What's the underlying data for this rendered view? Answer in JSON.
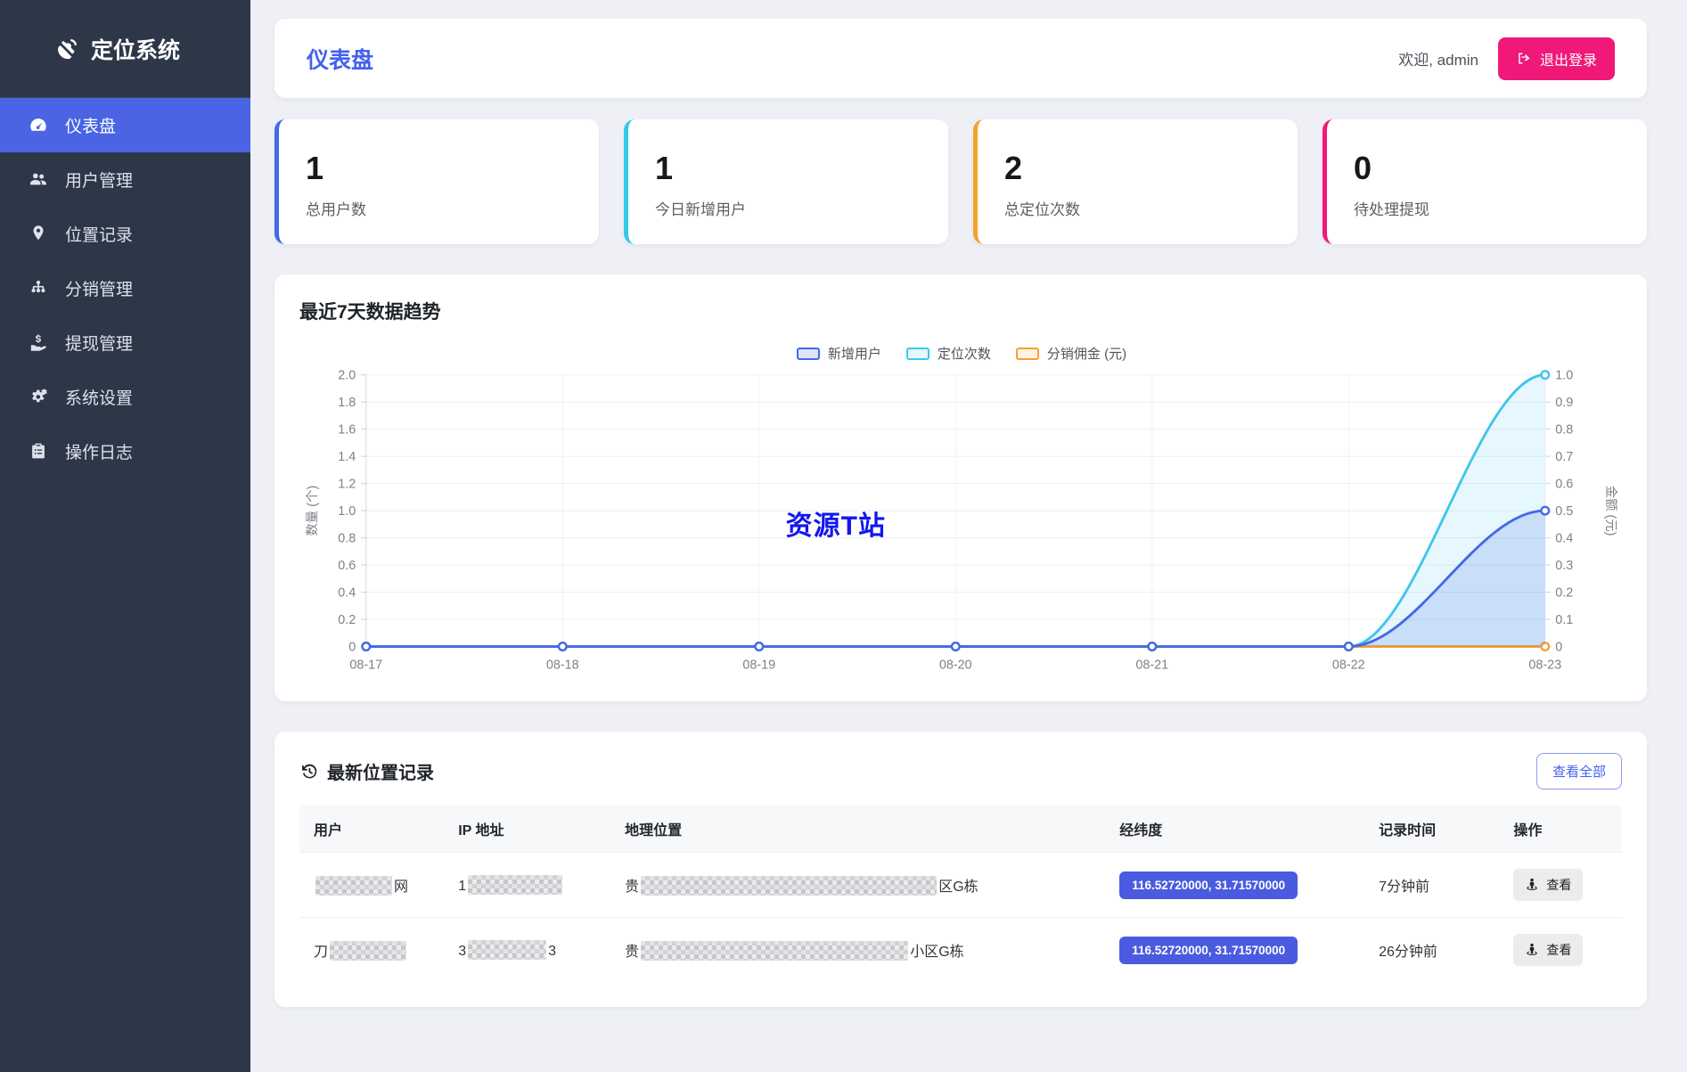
{
  "app": {
    "logo": "定位系统"
  },
  "sidebar": {
    "items": [
      {
        "id": "dashboard",
        "label": "仪表盘",
        "icon": "dashboard-icon",
        "active": true
      },
      {
        "id": "users",
        "label": "用户管理",
        "icon": "users-icon",
        "active": false
      },
      {
        "id": "locations",
        "label": "位置记录",
        "icon": "map-marker-icon",
        "active": false
      },
      {
        "id": "distribution",
        "label": "分销管理",
        "icon": "sitemap-icon",
        "active": false
      },
      {
        "id": "withdraw",
        "label": "提现管理",
        "icon": "hand-dollar-icon",
        "active": false
      },
      {
        "id": "settings",
        "label": "系统设置",
        "icon": "gear-icon",
        "active": false
      },
      {
        "id": "logs",
        "label": "操作日志",
        "icon": "clipboard-icon",
        "active": false
      }
    ]
  },
  "header": {
    "title": "仪表盘",
    "welcome": "欢迎, admin",
    "logout_label": "退出登录",
    "logout_color": "#f01879"
  },
  "stats": [
    {
      "value": "1",
      "label": "总用户数",
      "color": "#4468e8"
    },
    {
      "value": "1",
      "label": "今日新增用户",
      "color": "#35c8e8"
    },
    {
      "value": "2",
      "label": "总定位次数",
      "color": "#f5a030"
    },
    {
      "value": "0",
      "label": "待处理提现",
      "color": "#f0197b"
    }
  ],
  "chart_card": {
    "title": "最近7天数据趋势",
    "watermark": "资源T站"
  },
  "chart_data": {
    "type": "line",
    "categories": [
      "08-17",
      "08-18",
      "08-19",
      "08-20",
      "08-21",
      "08-22",
      "08-23"
    ],
    "series": [
      {
        "name": "新增用户",
        "axis": "left",
        "color": "#4468e8",
        "area": "rgba(68,104,232,0.18)",
        "values": [
          0,
          0,
          0,
          0,
          0,
          0,
          1
        ]
      },
      {
        "name": "定位次数",
        "axis": "left",
        "color": "#3fc6ec",
        "area": "rgba(63,198,236,0.13)",
        "values": [
          0,
          0,
          0,
          0,
          0,
          0,
          2
        ]
      },
      {
        "name": "分销佣金 (元)",
        "axis": "right",
        "color": "#f5a030",
        "area": "rgba(245,160,48,0.12)",
        "values": [
          0,
          0,
          0,
          0,
          0,
          0,
          0
        ]
      }
    ],
    "ylabel_left": "数量 (个)",
    "ylabel_right": "金额 (元)",
    "left_axis": {
      "min": 0,
      "max": 2,
      "ticks": [
        0,
        0.2,
        0.4,
        0.6,
        0.8,
        1.0,
        1.2,
        1.4,
        1.6,
        1.8,
        2.0
      ]
    },
    "right_axis": {
      "min": 0,
      "max": 1,
      "ticks": [
        0,
        0.1,
        0.2,
        0.3,
        0.4,
        0.5,
        0.6,
        0.7,
        0.8,
        0.9,
        1.0
      ]
    },
    "grid": true,
    "legend_position": "top-center",
    "smooth": true
  },
  "records": {
    "title": "最新位置记录",
    "view_all_label": "查看全部",
    "columns": [
      "用户",
      "IP 地址",
      "地理位置",
      "经纬度",
      "记录时间",
      "操作"
    ],
    "rows": [
      {
        "user": [
          {
            "mask": "s"
          },
          {
            "text": "网"
          }
        ],
        "ip": [
          {
            "text": "1"
          },
          {
            "mask": "m"
          }
        ],
        "location": [
          {
            "text": "贵"
          },
          {
            "mask": "xl"
          },
          {
            "text": "区G栋"
          }
        ],
        "coords": "116.52720000, 31.71570000",
        "time": "7分钟前",
        "action": "查看"
      },
      {
        "user": [
          {
            "text": "刀"
          },
          {
            "mask": "s"
          }
        ],
        "ip": [
          {
            "text": "3"
          },
          {
            "mask": "s2"
          },
          {
            "text": "3"
          }
        ],
        "location": [
          {
            "text": "贵"
          },
          {
            "mask": "l"
          },
          {
            "text": "小区G栋"
          }
        ],
        "coords": "116.52720000, 31.71570000",
        "time": "26分钟前",
        "action": "查看"
      }
    ]
  }
}
